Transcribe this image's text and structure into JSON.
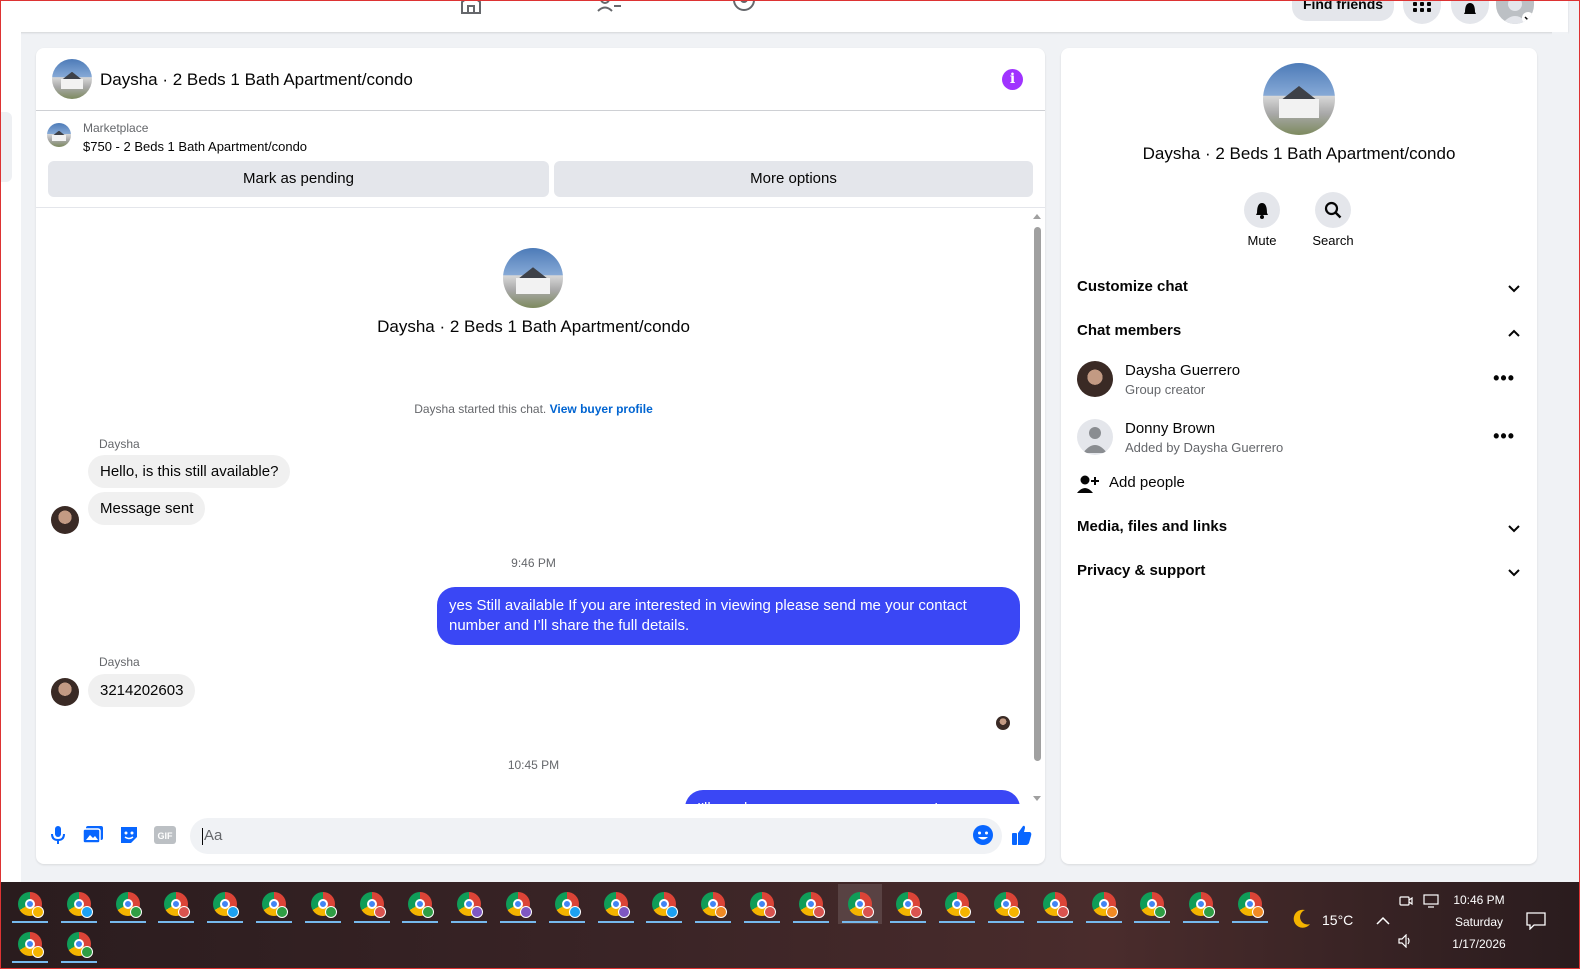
{
  "topnav": {
    "find_friends_label": "Find friends",
    "icons": [
      "home-icon",
      "friends-icon",
      "groups-icon",
      "menu-grid-icon",
      "bell-icon",
      "account-icon"
    ]
  },
  "chat": {
    "title": "Daysha · 2 Beds 1 Bath Apartment/condo",
    "info_icon": "i",
    "listing": {
      "label": "Marketplace",
      "price_title": "$750 - 2 Beds 1 Bath Apartment/condo",
      "mark_pending": "Mark as pending",
      "more_options": "More options"
    },
    "intro": {
      "title": "Daysha · 2 Beds 1 Bath Apartment/condo",
      "started_text": "Daysha started this chat.",
      "view_profile": "View buyer profile"
    },
    "messages": [
      {
        "sender": "Daysha",
        "text": "Hello, is this still available?"
      },
      {
        "text": "Message sent"
      },
      {
        "timestamp": "9:46 PM"
      },
      {
        "text": "yes Still available If you are interested in viewing please send me your contact number and I’ll share the full details."
      },
      {
        "sender": "Daysha",
        "text": "3214202603"
      },
      {
        "timestamp": "10:45 PM"
      },
      {
        "text": "I'll send you a message as soon as I can. Thanks"
      }
    ],
    "composer": {
      "placeholder": "Aa"
    }
  },
  "info": {
    "title": "Daysha · 2 Beds 1 Bath Apartment/condo",
    "mute_label": "Mute",
    "search_label": "Search",
    "customize_chat": "Customize chat",
    "chat_members": "Chat members",
    "members": [
      {
        "name": "Daysha Guerrero",
        "subtitle": "Group creator"
      },
      {
        "name": "Donny Brown",
        "subtitle": "Added by Daysha Guerrero"
      }
    ],
    "add_people": "Add people",
    "media": "Media, files and links",
    "privacy": "Privacy & support"
  },
  "taskbar": {
    "weather_temp": "15°C",
    "time": "10:46 PM",
    "day": "Saturday",
    "date": "1/17/2026",
    "badge_colors": [
      "#f4b400",
      "#1da1f2",
      "#2f9e44",
      "#d9534f",
      "#1da1f2",
      "#2f9e44",
      "#2f9e44",
      "#d9534f",
      "#2f9e44",
      "#7e57c2",
      "#7e57c2",
      "#1da1f2",
      "#7e57c2",
      "#1da1f2",
      "#f08a24",
      "#d9534f",
      "#d9534f",
      "#d9534f",
      "#d9534f",
      "#f4b400",
      "#f4b400",
      "#d9534f",
      "#f08a24",
      "#2f9e44",
      "#2f9e44",
      "#f08a24",
      "#f4b400",
      "#2f9e44"
    ]
  },
  "colors": {
    "accent_blue": "#3a47f5",
    "info_purple": "#a033ff",
    "link_blue": "#0064d1"
  }
}
